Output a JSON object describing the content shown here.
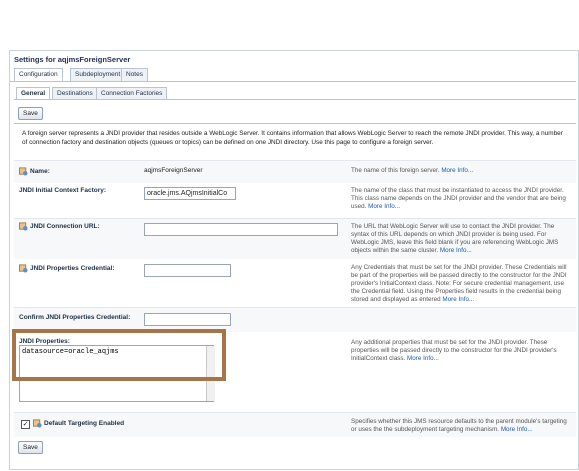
{
  "panel_title": "Settings for aqjmsForeignServer",
  "tabs": [
    "Configuration",
    "Subdeployment",
    "Notes"
  ],
  "subtabs": [
    "General",
    "Destinations",
    "Connection Factories"
  ],
  "save_label": "Save",
  "intro": "A foreign server represents a JNDI provider that resides outside a WebLogic Server. It contains information that allows WebLogic Server to reach the remote JNDI provider. This way, a number of connection factory and destination objects (queues or topics) can be defined on one JNDI directory. Use this page to configure a foreign server.",
  "more_info": "More Info...",
  "fields": {
    "name": {
      "label": "Name:",
      "value": "aqjmsForeignServer",
      "help": "The name of this foreign server."
    },
    "initial_context": {
      "label": "JNDI Initial Context Factory:",
      "value": "oracle.jms.AQjmsInitialCo",
      "help": "The name of the class that must be instantiated to access the JNDI provider. This class name depends on the JNDI provider and the vendor that are being used."
    },
    "connection_url": {
      "label": "JNDI Connection URL:",
      "value": "",
      "help": "The URL that WebLogic Server will use to contact the JNDI provider. The syntax of this URL depends on which JNDI provider is being used. For WebLogic JMS, leave this field blank if you are referencing WebLogic JMS objects within the same cluster."
    },
    "credential": {
      "label": "JNDI Properties Credential:",
      "value": "",
      "help": "Any Credentials that must be set for the JNDI provider. These Credentials will be part of the properties will be passed directly to the constructor for the JNDI provider's InitialContext class. Note: For secure credential management, use the Credential field. Using the Properties field results in the credential being stored and displayed as entered"
    },
    "confirm_credential": {
      "label": "Confirm JNDI Properties Credential:",
      "value": ""
    },
    "properties": {
      "label": "JNDI Properties:",
      "value": "datasource=oracle_aqjms",
      "help": "Any additional properties that must be set for the JNDI provider. These properties will be passed directly to the constructor for the JNDI provider's InitialContext class."
    },
    "default_targeting": {
      "label": "Default Targeting Enabled",
      "checked": true,
      "help": "Specifies whether this JMS resource defaults to the parent module's targeting or uses the the subdeployment targeting mechanism."
    }
  }
}
